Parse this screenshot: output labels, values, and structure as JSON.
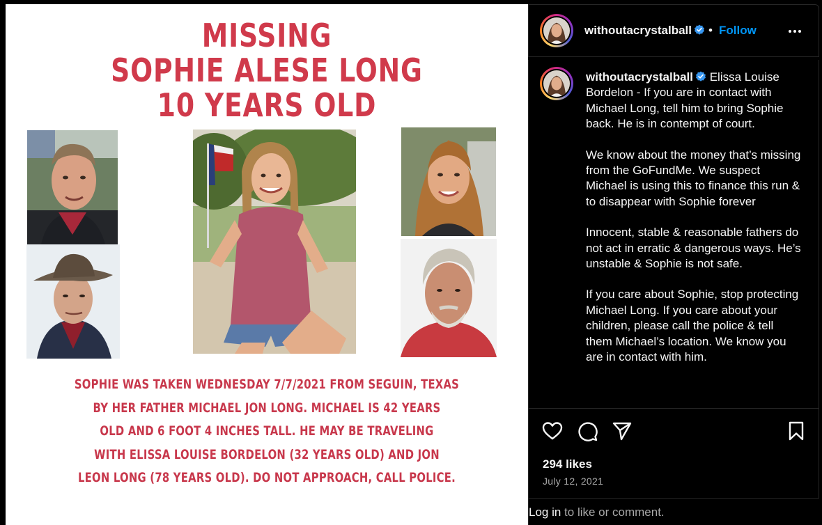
{
  "poster": {
    "heading_missing": "MISSING",
    "heading_name": "SOPHIE ALESE LONG",
    "heading_age": "10 YEARS OLD",
    "body_lines": [
      "SOPHIE WAS TAKEN WEDNESDAY 7/7/2021 FROM SEGUIN, TEXAS",
      "BY HER FATHER MICHAEL JON LONG. MICHAEL IS 42 YEARS",
      "OLD AND 6 FOOT 4 INCHES TALL. HE MAY BE TRAVELING",
      "WITH ELISSA LOUISE BORDELON (32 YEARS OLD) AND JON",
      "LEON LONG (78 YEARS OLD). DO NOT APPROACH, CALL POLICE."
    ],
    "heading_color": "#d03a4b"
  },
  "header": {
    "username": "withoutacrystalball",
    "separator": "•",
    "follow_label": "Follow"
  },
  "caption": {
    "username": "withoutacrystalball",
    "paragraph_1": "Elissa Louise Bordelon - If you are in contact with Michael Long, tell him to bring Sophie back. He is in contempt of court.",
    "paragraph_2": "We know about the money that’s missing from the GoFundMe. We suspect Michael is using this to finance this run & to disappear with Sophie forever",
    "paragraph_3": "Innocent, stable & reasonable fathers do not act in erratic & dangerous ways. He’s unstable & Sophie is not safe.",
    "paragraph_4": "If you care about Sophie, stop protecting Michael Long. If you care about your children, please call the police & tell them Michael’s location. We know you are in contact with him."
  },
  "engagement": {
    "likes": "294 likes",
    "date": "July 12, 2021"
  },
  "login": {
    "link": "Log in",
    "rest": " to like or comment."
  },
  "colors": {
    "follow": "#0095f6",
    "verified": "#3897f0",
    "border": "#262626"
  }
}
